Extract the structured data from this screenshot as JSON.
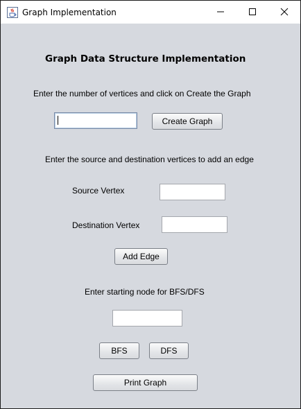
{
  "window": {
    "title": "Graph Implementation",
    "app_icon": "java-cup-icon",
    "controls": [
      "minimize-icon",
      "maximize-icon",
      "close-icon"
    ]
  },
  "main": {
    "heading": "Graph Data Structure Implementation",
    "create_section": {
      "instruction": "Enter the number of vertices and click on Create the Graph",
      "vertices_value": "",
      "create_button_label": "Create Graph"
    },
    "edge_section": {
      "instruction": "Enter the source and destination vertices to add an edge",
      "source_label": "Source Vertex",
      "source_value": "",
      "destination_label": "Destination Vertex",
      "destination_value": "",
      "add_edge_button_label": "Add Edge"
    },
    "traversal_section": {
      "instruction": "Enter starting node for BFS/DFS",
      "start_node_value": "",
      "bfs_button_label": "BFS",
      "dfs_button_label": "DFS"
    },
    "print_button_label": "Print Graph"
  },
  "colors": {
    "panel_background": "#d6d9df",
    "titlebar_background": "#ffffff",
    "window_border": "#1b1b1b"
  }
}
